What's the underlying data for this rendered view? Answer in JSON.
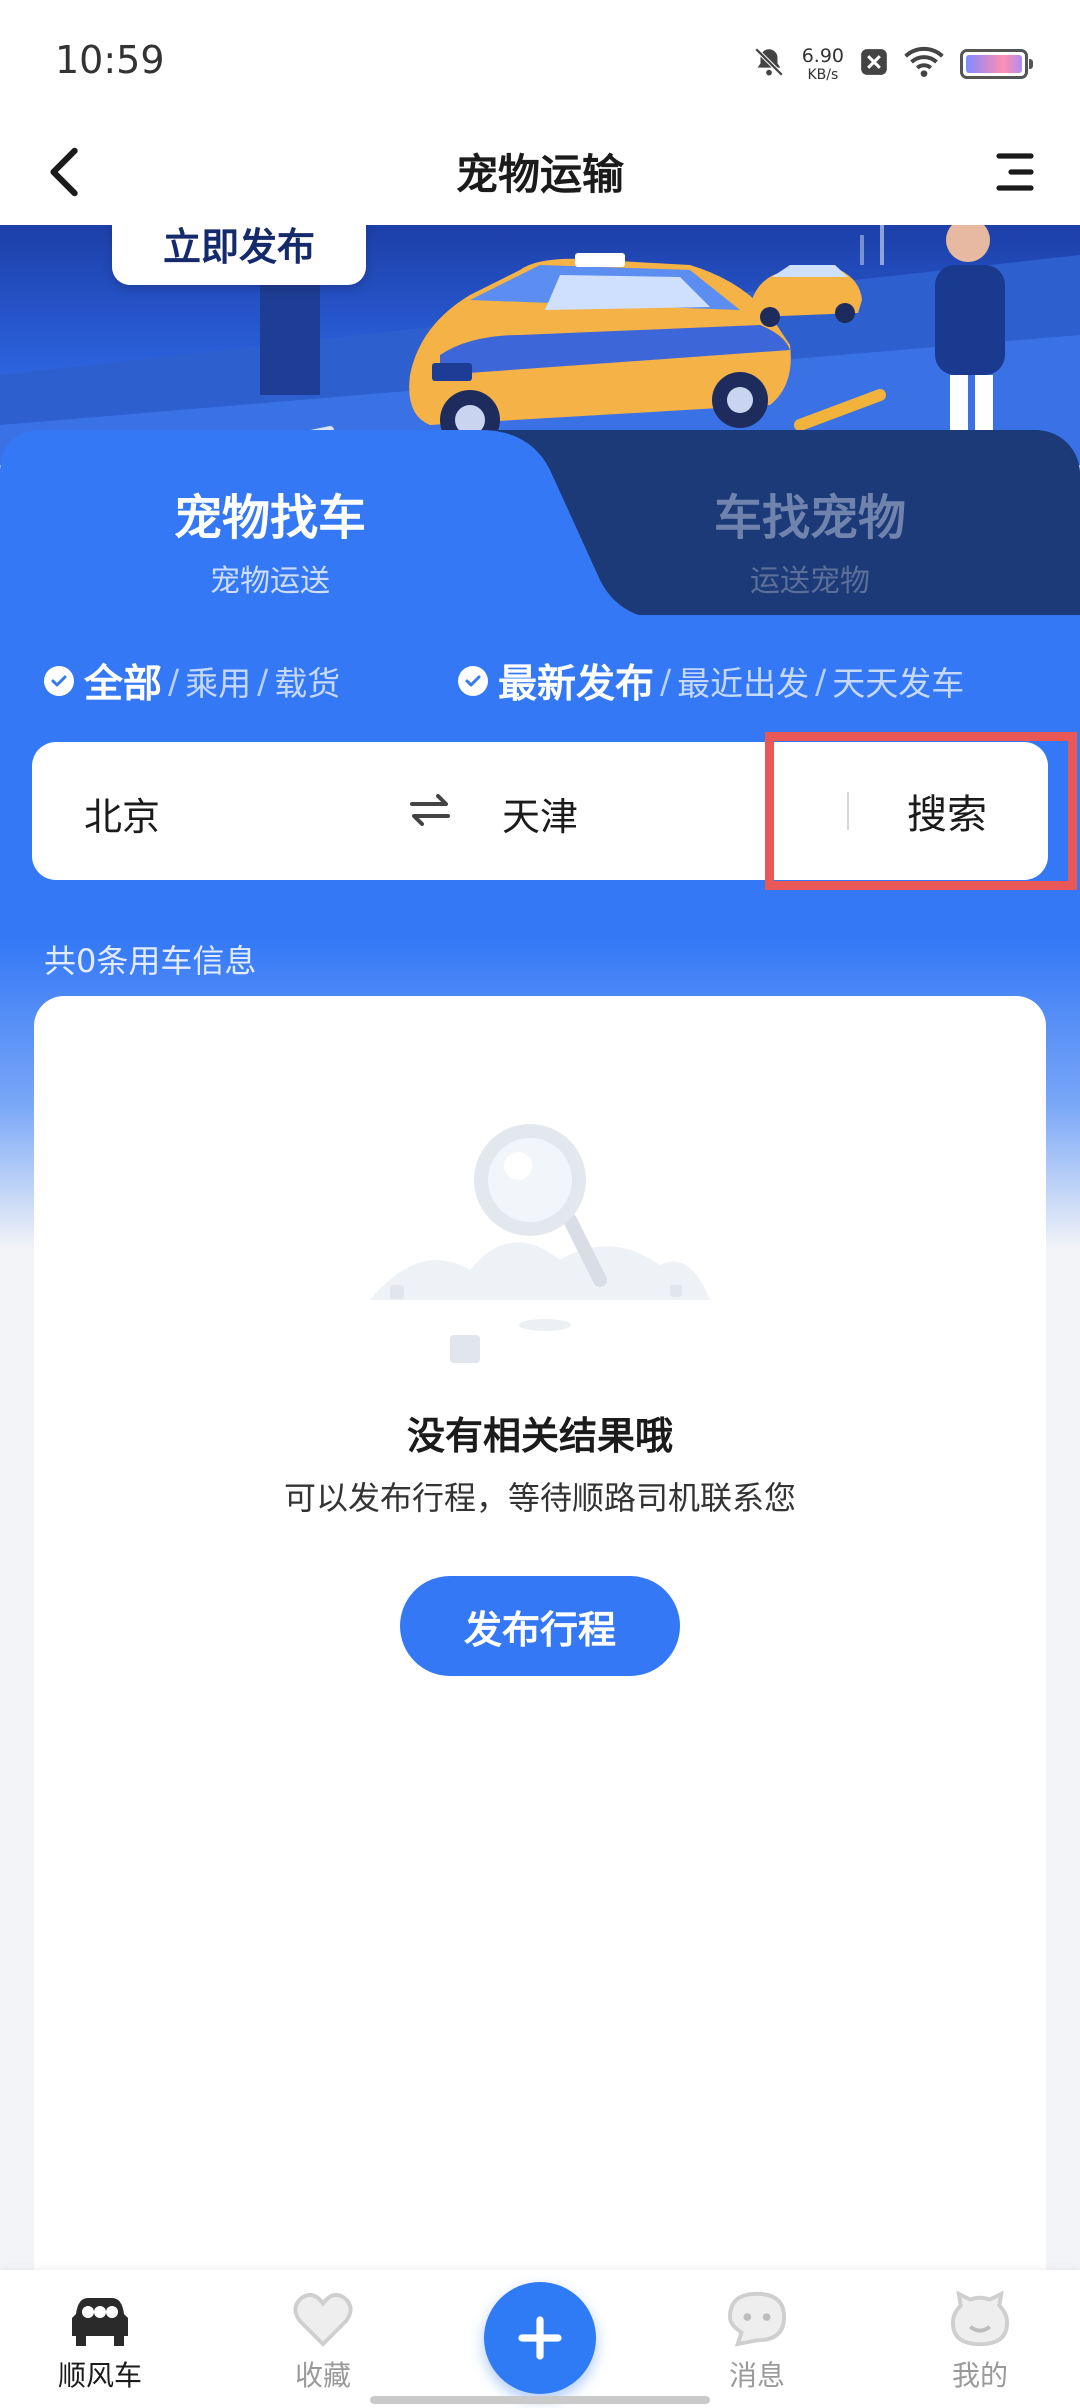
{
  "status_bar": {
    "time": "10:59",
    "net_speed_value": "6.90",
    "net_speed_unit": "KB/s",
    "icons": [
      "bell-off-icon",
      "close-box-icon",
      "wifi-icon",
      "battery-icon"
    ]
  },
  "header": {
    "title": "宠物运输",
    "back_icon": "chevron-left-icon",
    "menu_icon": "menu-icon"
  },
  "banner": {
    "publish_label": "立即发布"
  },
  "tabs": [
    {
      "label": "宠物找车",
      "sub": "宠物运送",
      "active": true
    },
    {
      "label": "车找宠物",
      "sub": "运送宠物",
      "active": false
    }
  ],
  "filters": {
    "type": {
      "active": "全部",
      "options": [
        "乘用",
        "载货"
      ]
    },
    "sort": {
      "active": "最新发布",
      "options": [
        "最近出发",
        "天天发车"
      ]
    }
  },
  "search": {
    "from": "北京",
    "to": "天津",
    "button": "搜索"
  },
  "results": {
    "count_text": "共0条用车信息",
    "empty_title": "没有相关结果哦",
    "empty_subtitle": "可以发布行程，等待顺路司机联系您",
    "publish_button": "发布行程"
  },
  "bottom_nav": {
    "items": [
      {
        "label": "顺风车",
        "icon": "car-icon",
        "active": true
      },
      {
        "label": "收藏",
        "icon": "heart-icon",
        "active": false
      },
      {
        "label": "消息",
        "icon": "chat-icon",
        "active": false
      },
      {
        "label": "我的",
        "icon": "profile-icon",
        "active": false
      }
    ],
    "fab_icon": "plus-icon"
  },
  "colors": {
    "primary": "#3478f6",
    "tab_inactive_bg": "#1c3a78",
    "highlight": "#e95757"
  }
}
